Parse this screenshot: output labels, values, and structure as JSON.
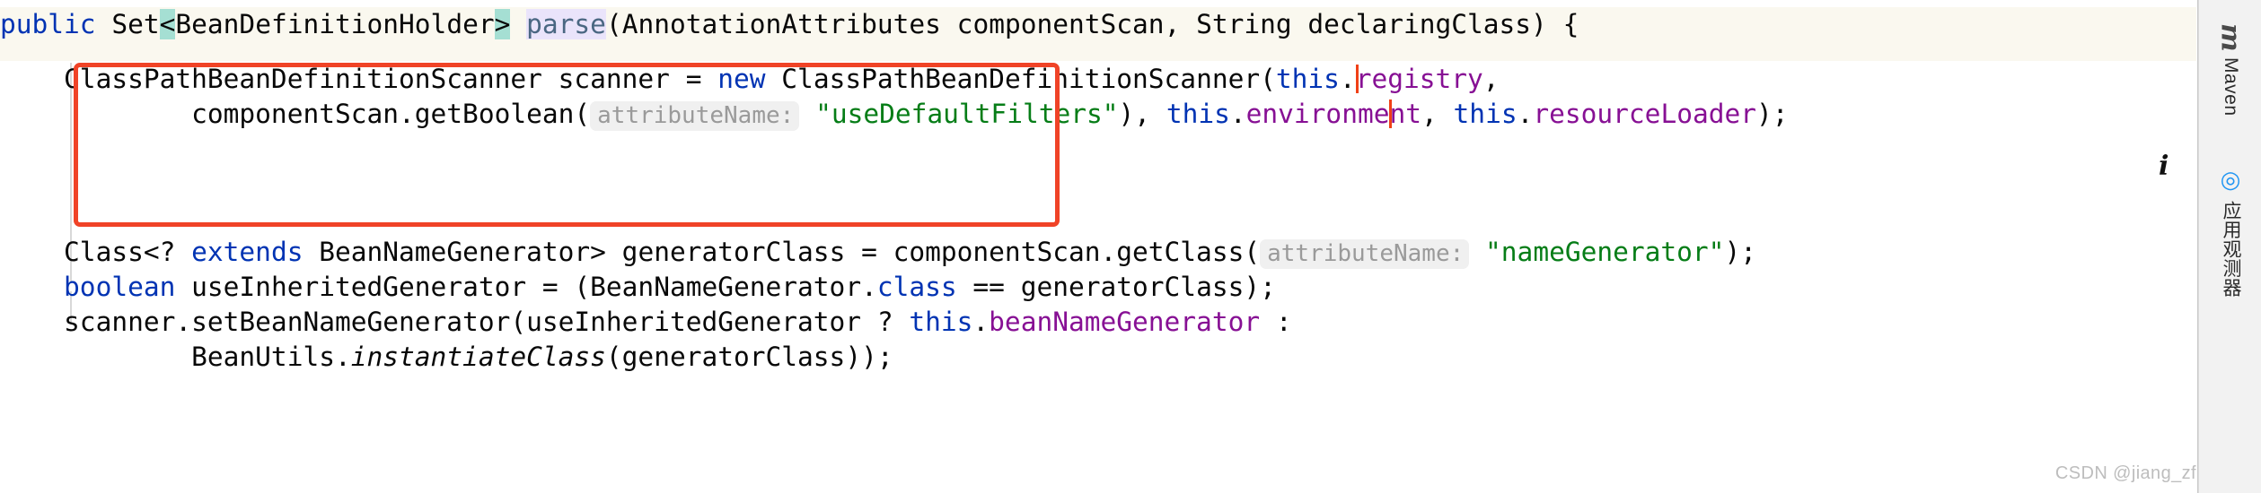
{
  "editor": {
    "language": "java",
    "colors": {
      "keyword": "#0033b3",
      "field": "#871094",
      "string": "#067d17",
      "method_declaration": "#4a6782",
      "default_text": "#080808",
      "current_line_bg": "#faf8ef",
      "bracket_match_bg": "#a5dfd3",
      "method_name_bg": "#eae4fb",
      "inlay_hint_fg": "#9a9a9a",
      "inlay_hint_bg": "#f0f0f0",
      "caret": "#f04016",
      "annotation_box": "#f04327"
    },
    "lines": [
      {
        "id": "line-1",
        "tokens": [
          {
            "text": "public",
            "style": "kw"
          },
          {
            "text": " Set",
            "style": "plain"
          },
          {
            "text": "<",
            "style": "brk"
          },
          {
            "text": "BeanDefinitionHolder",
            "style": "plain"
          },
          {
            "text": ">",
            "style": "brk"
          },
          {
            "text": " ",
            "style": "plain"
          },
          {
            "text": "parse",
            "style": "mth-hl"
          },
          {
            "text": "(AnnotationAttributes componentScan, String declaringClass) {",
            "style": "plain"
          }
        ]
      },
      {
        "id": "line-2",
        "tokens": [
          {
            "text": "    ClassPathBeanDefinitionScanner scanner = ",
            "style": "plain"
          },
          {
            "text": "new",
            "style": "kw"
          },
          {
            "text": " ClassPathBeanDefinitionScanner(",
            "style": "plain"
          },
          {
            "text": "this",
            "style": "kw"
          },
          {
            "text": ".",
            "style": "plain"
          },
          {
            "text": "caret",
            "style": "caret"
          },
          {
            "text": "registry",
            "style": "fld"
          },
          {
            "text": ",",
            "style": "plain"
          }
        ]
      },
      {
        "id": "line-3",
        "tokens": [
          {
            "text": "            componentScan.getBoolean(",
            "style": "plain"
          },
          {
            "text": "attributeName:",
            "style": "hint"
          },
          {
            "text": " ",
            "style": "plain"
          },
          {
            "text": "\"useDefaultFilters\"",
            "style": "str"
          },
          {
            "text": "), ",
            "style": "plain"
          },
          {
            "text": "this",
            "style": "kw"
          },
          {
            "text": ".",
            "style": "plain"
          },
          {
            "text": "environme",
            "style": "fld"
          },
          {
            "text": "caret",
            "style": "caret"
          },
          {
            "text": "nt",
            "style": "fld"
          },
          {
            "text": ", ",
            "style": "plain"
          },
          {
            "text": "this",
            "style": "kw"
          },
          {
            "text": ".",
            "style": "plain"
          },
          {
            "text": "resourceLoader",
            "style": "fld"
          },
          {
            "text": ");",
            "style": "plain"
          }
        ]
      },
      {
        "id": "line-4",
        "tokens": [
          {
            "text": "    Class<? ",
            "style": "plain"
          },
          {
            "text": "extends",
            "style": "kw"
          },
          {
            "text": " BeanNameGenerator> generatorClass = componentScan.getClass(",
            "style": "plain"
          },
          {
            "text": "attributeName:",
            "style": "hint"
          },
          {
            "text": " ",
            "style": "plain"
          },
          {
            "text": "\"nameGenerator\"",
            "style": "str"
          },
          {
            "text": ");",
            "style": "plain"
          }
        ]
      },
      {
        "id": "line-5",
        "tokens": [
          {
            "text": "    ",
            "style": "plain"
          },
          {
            "text": "boolean",
            "style": "kw"
          },
          {
            "text": " useInheritedGenerator = (BeanNameGenerator.",
            "style": "plain"
          },
          {
            "text": "class",
            "style": "kw"
          },
          {
            "text": " == generatorClass);",
            "style": "plain"
          }
        ]
      },
      {
        "id": "line-6",
        "tokens": [
          {
            "text": "    scanner.setBeanNameGenerator(useInheritedGenerator ? ",
            "style": "plain"
          },
          {
            "text": "this",
            "style": "kw"
          },
          {
            "text": ".",
            "style": "plain"
          },
          {
            "text": "beanNameGenerator",
            "style": "fld"
          },
          {
            "text": " :",
            "style": "plain"
          }
        ]
      },
      {
        "id": "line-7",
        "tokens": [
          {
            "text": "            BeanUtils.",
            "style": "plain"
          },
          {
            "text": "instantiateClass",
            "style": "ital"
          },
          {
            "text": "(generatorClass));",
            "style": "plain"
          }
        ]
      }
    ]
  },
  "annotation": {
    "shape": "rectangle",
    "color": "#f04327",
    "covers_lines": "line-2 to line-3"
  },
  "tool_window_bar": {
    "items": [
      {
        "id": "maven",
        "icon": "maven-m-icon",
        "label": "Maven"
      },
      {
        "id": "app-observer",
        "icon": "app-observer-icon",
        "label": "应用观测器"
      }
    ]
  },
  "gutter": {
    "info_marker": "i"
  },
  "watermark": {
    "text": "CSDN @jiang_zf"
  }
}
